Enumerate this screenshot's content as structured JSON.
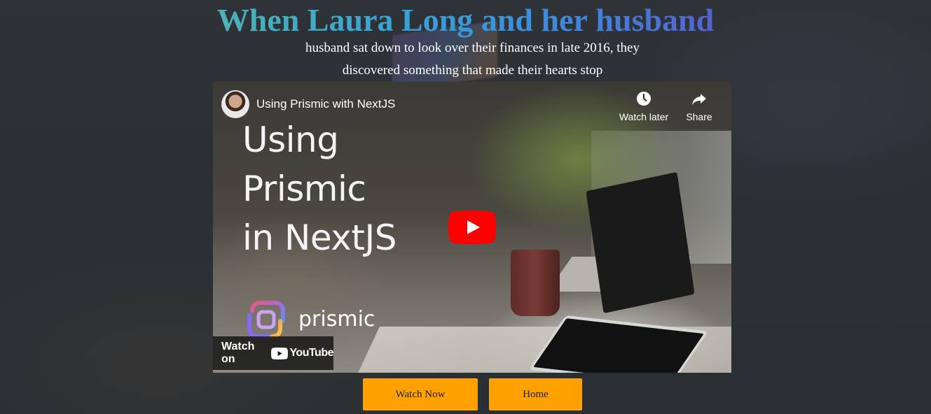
{
  "headline": [
    "When",
    "Laura",
    "Long",
    "and",
    "her",
    "husband"
  ],
  "subtitle": {
    "line1": "husband sat down to look over their finances in late 2016, they",
    "line2": "discovered something that made their hearts stop"
  },
  "video": {
    "channel_title": "Using Prismic with NextJS",
    "watch_later_label": "Watch later",
    "share_label": "Share",
    "thumbnail_title": [
      "Using",
      "Prismic",
      "in NextJS"
    ],
    "brand_word": "prismic",
    "watch_on_label": "Watch on",
    "youtube_label": "YouTube",
    "play_color": "#ff0000"
  },
  "buttons": {
    "watch_now": "Watch Now",
    "home": "Home"
  },
  "colors": {
    "button_bg": "#ffa100",
    "page_bg": "#2c3135"
  }
}
